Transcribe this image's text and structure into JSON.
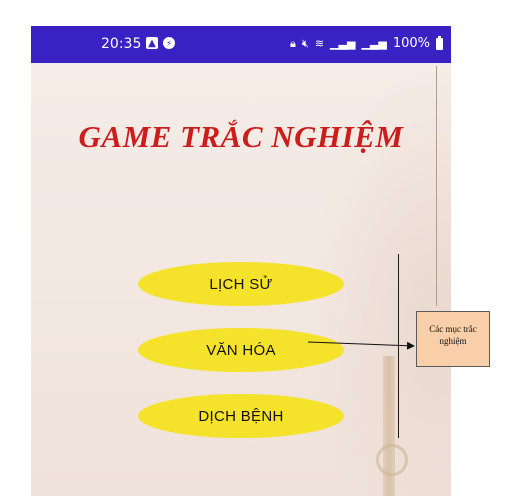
{
  "status_bar": {
    "time": "20:35",
    "left_icons": [
      "gallery-icon",
      "messenger-icon"
    ],
    "right_icons": [
      "lock-icon",
      "mute-icon",
      "wifi-icon",
      "signal-icon",
      "signal-icon",
      "battery-charging-icon"
    ],
    "battery": "100%"
  },
  "app": {
    "title": "GAME TRẮC NGHIỆM",
    "buttons": [
      {
        "label": "LỊCH SỬ"
      },
      {
        "label": "VĂN HÓA"
      },
      {
        "label": "DỊCH BỆNH"
      }
    ]
  },
  "annotation": {
    "text_line1": "Các mục trắc",
    "text_line2": "nghiệm"
  },
  "colors": {
    "status_bar": "#3a21c4",
    "title": "#cc1d1d",
    "button": "#f5e22a",
    "background": "#f6ede8",
    "note_box": "#f8cfa8"
  }
}
